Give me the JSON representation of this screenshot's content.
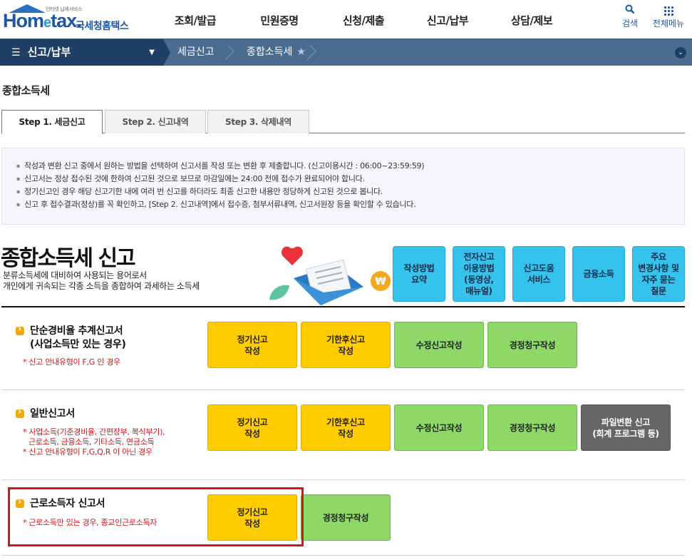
{
  "header": {
    "logo_tag": "인터넷 납세서비스",
    "logo_text_a": "Hom",
    "logo_text_e": "e",
    "logo_text_b": "tax.",
    "logo_kr": "국세청홈택스",
    "nav": [
      "조회/발급",
      "민원증명",
      "신청/제출",
      "신고/납부",
      "상담/제보"
    ],
    "search_label": "검색",
    "all_menu_label": "전체메뉴"
  },
  "location": {
    "main": "신고/납부",
    "crumbs": [
      "세금신고",
      "종합소득세"
    ]
  },
  "page_title": "종합소득세",
  "tabs": [
    "Step 1. 세금신고",
    "Step 2. 신고내역",
    "Step 3. 삭제내역"
  ],
  "notice": [
    "작성과 변환 신고 중에서 원하는 방법을 선택하여 신고서를 작성 또는 변환 후 제출합니다. (신고이용시간 : 06:00~23:59:59)",
    "신고서는 정상 접수된 것에 한하여 신고된 것으로 보므로 마감일에는 24:00 전에 접수가 완료되어야 합니다.",
    "정기신고인 경우 해당 신고기한 내에 여러 번 신고를 하더라도 최종 신고한 내용만 정당하게 신고된 것으로 봅니다.",
    "신고 후 접수결과(정상)를 꼭 확인하고, [Step 2. 신고내역]에서 접수증, 첨부서류내역, 신고서원장 등을 확인할 수 있습니다."
  ],
  "section": {
    "title": "종합소득세 신고",
    "desc": [
      "분류소득세에 대비하여 사용되는 용어로서",
      "개인에게 귀속되는 각종 소득을 종합하여 과세하는 소득세"
    ],
    "quick_links": [
      "작성방법\n요약",
      "전자신고\n이용방법\n(동영상,\n매뉴얼)",
      "신고도움\n서비스",
      "금융소득",
      "주요\n변경사항 및\n자주 묻는\n질문"
    ]
  },
  "rows": [
    {
      "title": "단순경비율 추계신고서\n(사업소득만 있는 경우)",
      "notes": [
        "* 신고 안내유형이 F,G 인 경우"
      ],
      "buttons": [
        "정기신고\n작성",
        "기한후신고\n작성",
        "수정신고작성",
        "경정청구작성"
      ]
    },
    {
      "title": "일반신고서",
      "notes": [
        "* 사업소득(기준경비율, 간편장부, 복식부기),",
        "근로소득, 금융소득, 기타소득, 연금소득",
        "* 신고 안내유형이 F,G,Q,R 이 아닌 경우"
      ],
      "buttons": [
        "정기신고\n작성",
        "기한후신고\n작성",
        "수정신고작성",
        "경정청구작성",
        "파일변환 신고\n(회계 프로그램 등)"
      ]
    },
    {
      "title": "근로소득자 신고서",
      "notes": [
        "* 근로소득만 있는 경우, 종교인근로소득자"
      ],
      "buttons": [
        "정기신고\n작성",
        "경정청구작성"
      ]
    }
  ],
  "colors": {
    "brand": "#1c57a8",
    "location_bar": "#4a6c8f",
    "location_main": "#1f3f67",
    "quick_link": "#35c3ee",
    "btn_yellow": "#ffcc00",
    "btn_green": "#8dd867",
    "btn_dark": "#666666",
    "note_red": "#d0161c",
    "highlight_red": "#d9121d"
  }
}
